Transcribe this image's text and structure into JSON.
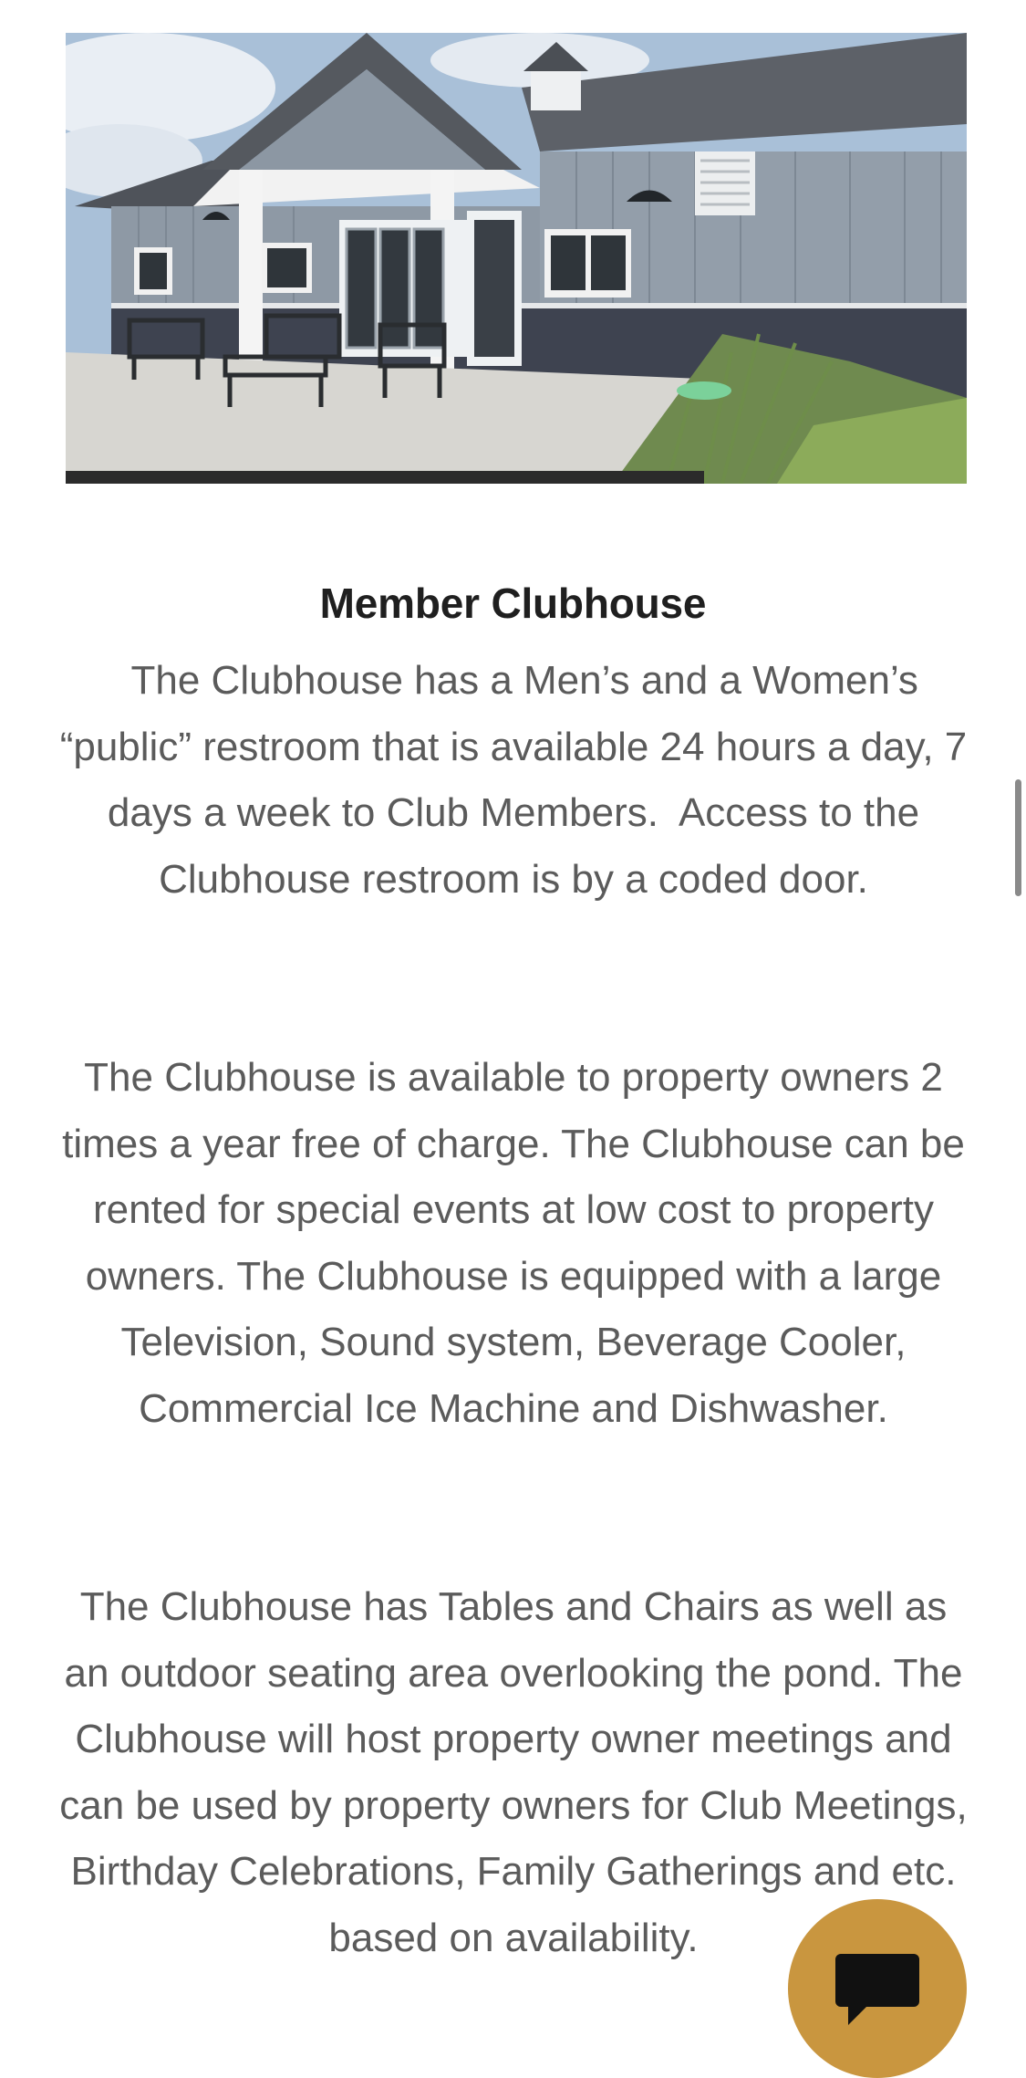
{
  "hero_image": {
    "alt": "Member clubhouse building with covered patio and outdoor seating"
  },
  "section": {
    "title": "Member Clubhouse",
    "paragraphs": [
      "  The Clubhouse has a Men’s and a Women’s “public” restroom that is available 24 hours a day, 7 days a week to Club Members.  Access to the Clubhouse restroom is by a coded door.",
      "The Clubhouse is available to property owners 2 times a year free of charge.  The Clubhouse can be rented for special events at low cost to property owners. The Clubhouse is equipped with a large Television, Sound system, Beverage Cooler, Commercial Ice Machine and Dishwasher.",
      "The Clubhouse has Tables and Chairs as well as an outdoor seating area overlooking the pond.  The Clubhouse will host property owner meetings and can be used by property owners for Club Meetings, Birthday Celebrations, Family Gatherings and etc. based on availability."
    ]
  },
  "chat_button": {
    "icon": "chat-bubble-icon",
    "color": "#c9963f"
  },
  "colors": {
    "title": "#1f1f1f",
    "body_text": "#5b5b5b",
    "accent": "#c9963f"
  }
}
